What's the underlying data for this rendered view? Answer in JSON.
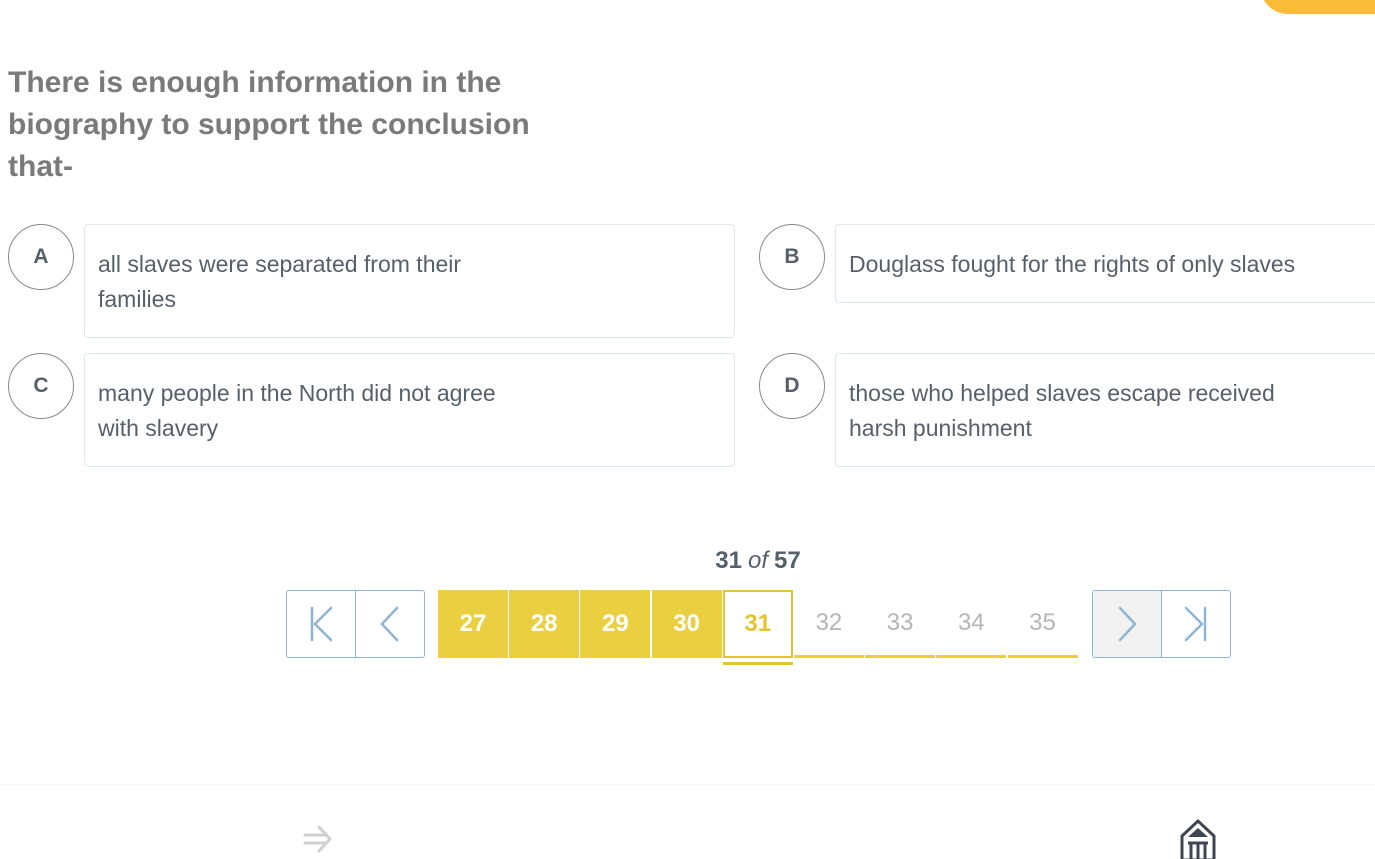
{
  "question": {
    "text": "There is enough information in the biography to support the conclusion that-"
  },
  "choices": [
    {
      "letter": "A",
      "lines": [
        "all slaves were separated from their",
        "families"
      ]
    },
    {
      "letter": "B",
      "lines": [
        "Douglass fought for the rights of only slaves"
      ]
    },
    {
      "letter": "C",
      "lines": [
        "many people in the North did not agree",
        "with slavery"
      ]
    },
    {
      "letter": "D",
      "lines": [
        "those who helped slaves escape received",
        "harsh punishment"
      ]
    }
  ],
  "pagination": {
    "current": "31",
    "of_label": "of",
    "total": "57",
    "pages": [
      {
        "label": "27",
        "state": "done"
      },
      {
        "label": "28",
        "state": "done"
      },
      {
        "label": "29",
        "state": "done"
      },
      {
        "label": "30",
        "state": "done"
      },
      {
        "label": "31",
        "state": "current"
      },
      {
        "label": "32",
        "state": "todo"
      },
      {
        "label": "33",
        "state": "todo"
      },
      {
        "label": "34",
        "state": "todo"
      },
      {
        "label": "35",
        "state": "todo"
      }
    ]
  },
  "icons": {
    "first": "first-page-icon",
    "prev": "previous-page-icon",
    "next": "next-page-icon",
    "last": "last-page-icon",
    "footer_left": "arrow-right-icon",
    "footer_right": "home-icon"
  },
  "colors": {
    "accent_orange": "#fbbb3a",
    "completed_yellow": "#ead041",
    "current_yellow": "#e4c531",
    "nav_blue": "#8fb4d4",
    "text_gray": "#56606b"
  }
}
